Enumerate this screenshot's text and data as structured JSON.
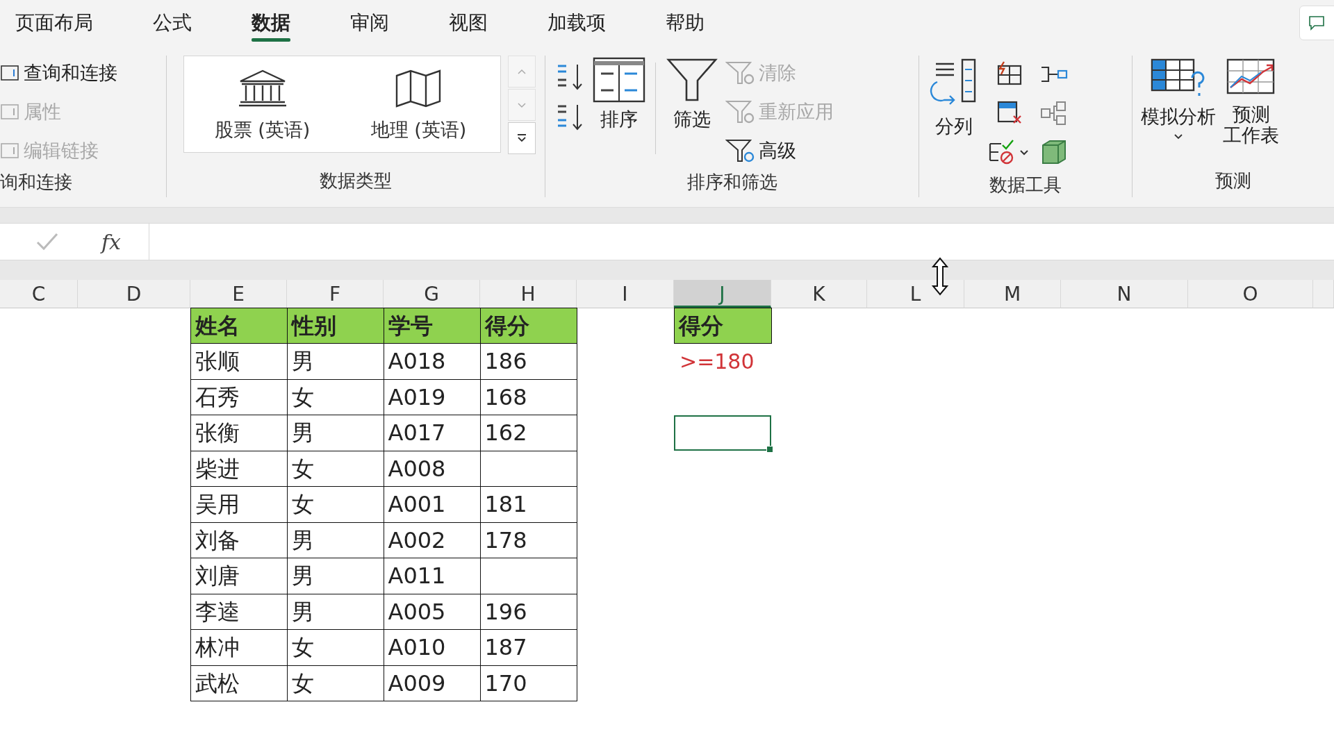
{
  "tabs": [
    {
      "label": "页面布局",
      "selected": false
    },
    {
      "label": "公式",
      "selected": false
    },
    {
      "label": "数据",
      "selected": true
    },
    {
      "label": "审阅",
      "selected": false
    },
    {
      "label": "视图",
      "selected": false
    },
    {
      "label": "加载项",
      "selected": false
    },
    {
      "label": "帮助",
      "selected": false
    }
  ],
  "ribbon": {
    "queries": {
      "items": [
        {
          "label": "查询和连接",
          "disabled": false
        },
        {
          "label": "属性",
          "disabled": true
        },
        {
          "label": "编辑链接",
          "disabled": true
        }
      ],
      "group_label": "询和连接"
    },
    "data_types": {
      "items": [
        {
          "label": "股票 (英语)",
          "kind": "stocks"
        },
        {
          "label": "地理 (英语)",
          "kind": "geography"
        }
      ],
      "group_label": "数据类型"
    },
    "sort_filter": {
      "sort_label": "排序",
      "filter_label": "筛选",
      "small": [
        {
          "label": "清除",
          "disabled": true
        },
        {
          "label": "重新应用",
          "disabled": true
        },
        {
          "label": "高级",
          "disabled": false
        }
      ],
      "group_label": "排序和筛选"
    },
    "data_tools": {
      "text_to_columns": "分列",
      "group_label": "数据工具"
    },
    "forecast": {
      "what_if": "模拟分析",
      "sheet_lines": [
        "预测",
        "工作表"
      ],
      "group_label": "预测"
    }
  },
  "formula_bar": {
    "fx": "fx"
  },
  "columns": [
    {
      "label": "C",
      "selected": false
    },
    {
      "label": "D",
      "selected": false
    },
    {
      "label": "E",
      "selected": false
    },
    {
      "label": "F",
      "selected": false
    },
    {
      "label": "G",
      "selected": false
    },
    {
      "label": "H",
      "selected": false
    },
    {
      "label": "I",
      "selected": false
    },
    {
      "label": "J",
      "selected": true
    },
    {
      "label": "K",
      "selected": false
    },
    {
      "label": "L",
      "selected": false
    },
    {
      "label": "M",
      "selected": false
    },
    {
      "label": "N",
      "selected": false
    },
    {
      "label": "O",
      "selected": false
    }
  ],
  "table": {
    "header": [
      "姓名",
      "性别",
      "学号",
      "得分"
    ],
    "rows": [
      [
        "张顺",
        "男",
        "A018",
        "186"
      ],
      [
        "石秀",
        "女",
        "A019",
        "168"
      ],
      [
        "张衡",
        "男",
        "A017",
        "162"
      ],
      [
        "柴进",
        "女",
        "A008",
        ""
      ],
      [
        "吴用",
        "女",
        "A001",
        "181"
      ],
      [
        "刘备",
        "男",
        "A002",
        "178"
      ],
      [
        "刘唐",
        "男",
        "A011",
        ""
      ],
      [
        "李逵",
        "男",
        "A005",
        "196"
      ],
      [
        "林冲",
        "女",
        "A010",
        "187"
      ],
      [
        "武松",
        "女",
        "A009",
        "170"
      ]
    ]
  },
  "criteria": [
    {
      "kind": "header",
      "text": "得分"
    },
    {
      "kind": "criterion",
      "text": ">=180"
    },
    {
      "kind": "blank",
      "selected": false
    },
    {
      "kind": "blank",
      "selected": true
    }
  ]
}
